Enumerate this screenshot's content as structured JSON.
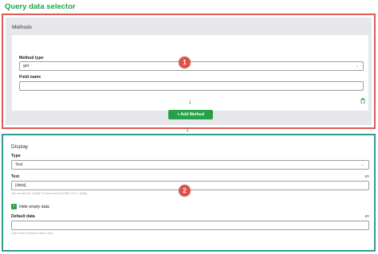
{
  "page": {
    "title": "Query data selector"
  },
  "methods": {
    "section_title": "Methods",
    "method_type_label": "Method type",
    "method_type_value": "get",
    "field_name_label": "Field name",
    "field_name_value": "",
    "add_button_label": "Add Method",
    "add_button_icon": "+",
    "badge_number": "1"
  },
  "display": {
    "section_title": "Display",
    "type_label": "Type",
    "type_value": "Text",
    "text_label": "Text",
    "text_lang": "en",
    "text_value": "{data}",
    "text_help": "You should use \"{data}\" to show text from field, Ex: 0, {data}",
    "hide_empty_label": "Hide empty data",
    "hide_empty_checked": true,
    "default_label": "Default data",
    "default_lang": "en",
    "default_value": "",
    "default_help": "Used when Required data is true",
    "badge_number": "2"
  },
  "colors": {
    "accent_green": "#27a048",
    "methods_border": "#e05a52",
    "display_border": "#2e9e8e",
    "badge": "#e0514a"
  }
}
